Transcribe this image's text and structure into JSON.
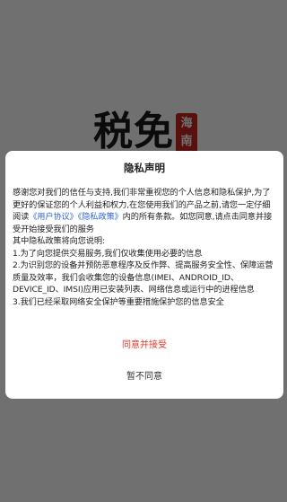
{
  "splash": {
    "logo_text": "税免",
    "logo_seal_top": "海",
    "logo_seal_bottom": "南"
  },
  "dialog": {
    "title": "隐私声明",
    "intro_before_links": "感谢您对我们的信任与支持,我们非常重视您的个人信息和隐私保护,为了更好的保证您的个人利益和权力,在您使用我们的产品之前,请您一定仔细阅读",
    "user_agreement_link": "《用户协议》",
    "privacy_policy_link": "《隐私政策》",
    "intro_after_links": "内的所有条款。如您同意,请点击同意并接受开始接受我们的服务",
    "policy_lead": "其中隐私政策将向您说明:",
    "point_1": "1.为了向您提供交易服务,我们仅收集使用必要的信息",
    "point_2": "2.为识别您的设备并预防恶意程序及反作弊、提高服务安全性、保障运营质量及效率，我们会收集您的设备信息(IMEI、ANDROID_ID、DEVICE_ID、IMSI)应用已安装列表、网络信息或运行中的进程信息",
    "point_3": "3.我们已经采取网络安全保护等重要措施保护您的信息安全",
    "agree_label": "同意并接受",
    "disagree_label": "暂不同意"
  },
  "colors": {
    "link": "#2f63d8",
    "agree": "#e03a2e",
    "seal": "#c8251f",
    "overlay": "rgba(0,0,0,0.56)"
  }
}
